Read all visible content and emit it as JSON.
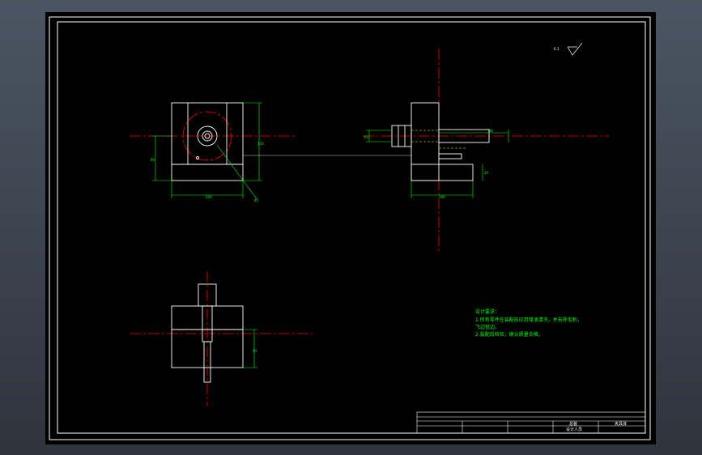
{
  "colors": {
    "background": "#000000",
    "outline": "#ffffff",
    "centerline": "#ff0000",
    "dimension": "#00ff00",
    "hidden": "#ffff00"
  },
  "drawing": {
    "dimensions": {
      "front_width": "200",
      "front_height": "150",
      "front_left": "90",
      "front_diag": "45",
      "side_width": "190",
      "side_bolt": "80",
      "side_right": "20",
      "side_left": "65",
      "plan_height": "90"
    },
    "surface_roughness": "6.3",
    "technical_notes": {
      "heading": "设计要求：",
      "line1": "1.所有零件在装配前应用煤油清洗，并去除毛刺，",
      "line2": "   飞边锐边。",
      "line3": "2.装配后检验，确认质量合格。"
    },
    "title_block": {
      "cell_a": "总装",
      "cell_b": "夹具体",
      "cell_c": "设计人员"
    }
  }
}
